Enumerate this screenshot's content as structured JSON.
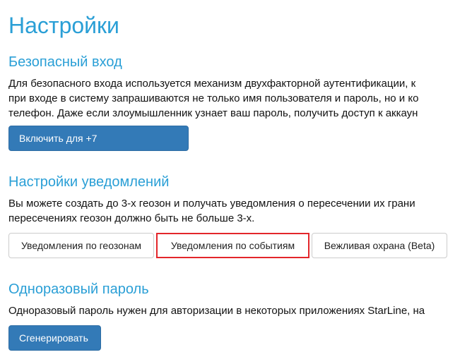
{
  "page": {
    "title": "Настройки"
  },
  "secure_login": {
    "title": "Безопасный вход",
    "lines": [
      "Для безопасного входа используется механизм двухфакторной аутентификации, к",
      "при входе в систему запрашиваются не только имя пользователя и пароль, но и ко",
      "телефон. Даже если злоумышленник узнает ваш пароль, получить доступ к аккаун"
    ],
    "button_label": "Включить для +7"
  },
  "notifications": {
    "title": "Настройки уведомлений",
    "lines": [
      "Вы можете создать до 3-х геозон и получать уведомления о пересечении их грани",
      "пересечениях геозон должно быть не больше 3-х."
    ],
    "buttons": [
      {
        "label": "Уведомления по геозонам"
      },
      {
        "label": "Уведомления по событиям"
      },
      {
        "label": "Вежливая охрана (Beta)"
      }
    ]
  },
  "one_time_password": {
    "title": "Одноразовый пароль",
    "lines": [
      "Одноразовый пароль нужен для авторизации в некоторых приложениях StarLine, на"
    ],
    "button_label": "Сгенерировать"
  },
  "colors": {
    "heading": "#2a9fd6",
    "primary_button": "#337ab7",
    "highlight_border": "#e3262b"
  }
}
